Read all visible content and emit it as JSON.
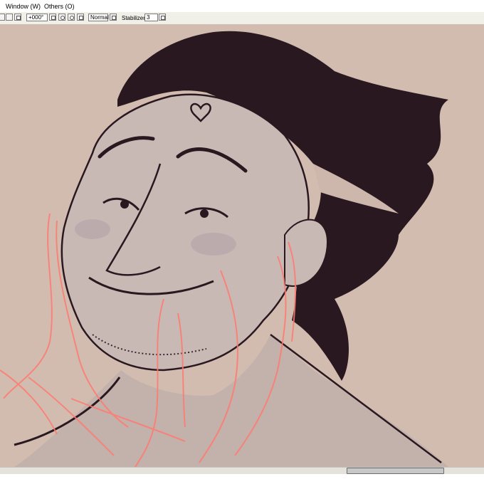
{
  "menubar": {
    "items": [
      {
        "label": "Window (W)"
      },
      {
        "label": "Others (O)"
      }
    ]
  },
  "toolbar": {
    "rotation_value": "+000°",
    "blend_mode": "Normal",
    "stabilizer_label": "Stabilizer",
    "stabilizer_value": "3"
  },
  "colors": {
    "canvas_bg": "#d2bcb0",
    "line_dark": "#2a1820",
    "sketch_red": "#ff7a70"
  },
  "scrollbar": {
    "position_fraction": 0.72
  }
}
